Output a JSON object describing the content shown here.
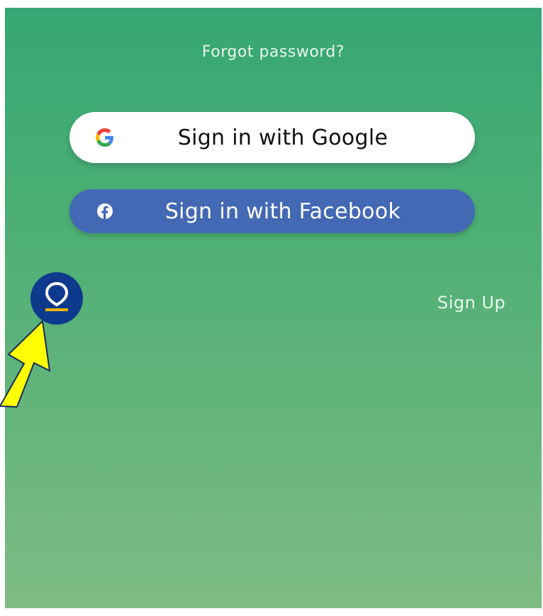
{
  "auth": {
    "forgot_password": "Forgot password?",
    "google_label": "Sign in with Google",
    "facebook_label": "Sign in with Facebook",
    "signup_label": "Sign Up"
  },
  "icons": {
    "google": "google-g-icon",
    "facebook": "facebook-f-icon",
    "location": "location-pin-icon",
    "annotation": "yellow-arrow-icon"
  },
  "colors": {
    "background_top": "#36a774",
    "background_bottom": "#7ebc83",
    "google_button_bg": "#ffffff",
    "facebook_button_bg": "#4368b4",
    "locator_bg": "#0d3a8c",
    "arrow_fill": "#ffff00"
  }
}
